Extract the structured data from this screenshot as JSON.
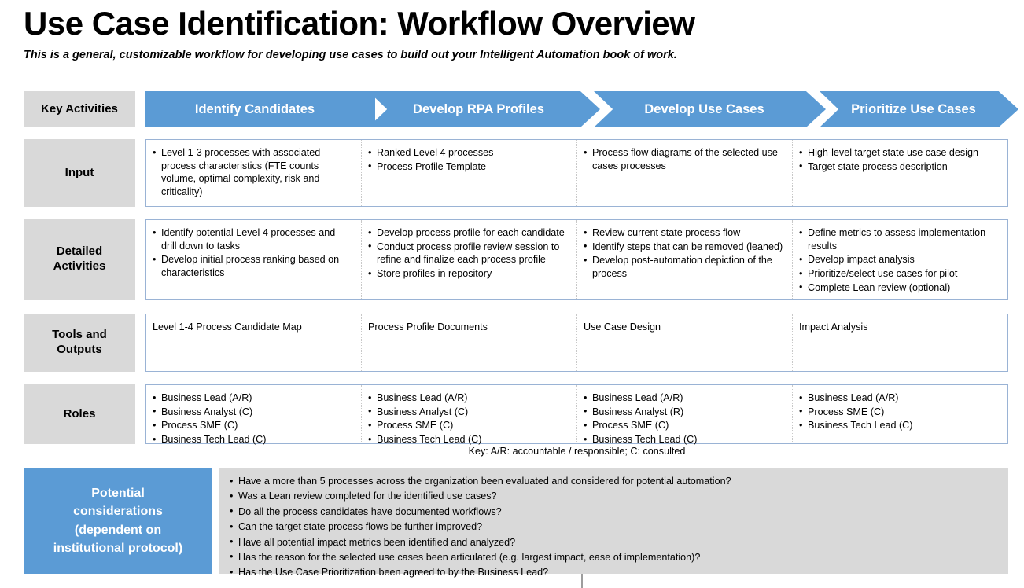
{
  "page": {
    "title": "Use Case Identification: Workflow Overview",
    "subtitle": "This is a general, customizable workflow for developing use cases to build out your Intelligent Automation book of work.",
    "accent_blue": "#5B9BD5",
    "label_gray": "#D9D9D9",
    "border_blue": "#9AB3D5"
  },
  "row_labels": {
    "key_activities": "Key Activities",
    "input": "Input",
    "detailed_activities": "Detailed\nActivities",
    "detailed_activities_line1": "Detailed",
    "detailed_activities_line2": "Activities",
    "tools_and_outputs_line1": "Tools  and",
    "tools_and_outputs_line2": "Outputs",
    "roles": "Roles"
  },
  "phases": [
    {
      "label": "Identify Candidates"
    },
    {
      "label": "Develop RPA Profiles"
    },
    {
      "label": "Develop Use Cases"
    },
    {
      "label": "Prioritize Use Cases"
    }
  ],
  "input_row": {
    "col1": [
      "Level 1-3 processes with associated process characteristics (FTE counts volume, optimal complexity, risk and criticality)"
    ],
    "col2": [
      "Ranked Level 4 processes",
      "Process Profile Template"
    ],
    "col3": [
      "Process flow diagrams of the selected use cases processes"
    ],
    "col4": [
      "High-level target state use case design",
      "Target state process description"
    ]
  },
  "detailed_activities_row": {
    "col1": [
      "Identify potential Level 4 processes and drill down to tasks",
      "Develop initial process  ranking based on characteristics"
    ],
    "col2": [
      "Develop process profile for each candidate",
      "Conduct process profile review session to refine and finalize each process profile",
      "Store profiles in repository"
    ],
    "col3": [
      "Review current state process flow",
      "Identify steps that can be removed (leaned)",
      "Develop post-automation depiction of the process"
    ],
    "col4": [
      "Define metrics to assess implementation results",
      "Develop impact analysis",
      "Prioritize/select use cases for pilot",
      "Complete Lean review (optional)"
    ]
  },
  "tools_outputs_row": {
    "col1": "Level 1-4 Process Candidate Map",
    "col2": "Process Profile Documents",
    "col3": "Use Case Design",
    "col4": "Impact Analysis"
  },
  "roles_row": {
    "col1": [
      "Business Lead (A/R)",
      "Business Analyst (C)",
      "Process SME (C)",
      "Business Tech Lead (C)"
    ],
    "col2": [
      "Business Lead (A/R)",
      "Business Analyst (C)",
      "Process SME (C)",
      "Business Tech Lead (C)"
    ],
    "col3": [
      "Business Lead (A/R)",
      "Business Analyst (R)",
      "Process SME (C)",
      "Business Tech Lead (C)"
    ],
    "col4": [
      "Business Lead (A/R)",
      "Process SME (C)",
      "Business Tech Lead (C)"
    ]
  },
  "key_note": "Key: A/R: accountable / responsible; C: consulted",
  "considerations": {
    "label_line1": "Potential",
    "label_line2": "considerations",
    "label_line3": "(dependent on",
    "label_line4": "institutional protocol)",
    "items": [
      "Have a more than 5 processes across the organization been evaluated and considered for potential automation?",
      "Was a Lean review completed for the identified use cases?",
      "Do all the process candidates have documented workflows?",
      "Can the target state process flows be further improved?",
      "Have all potential impact metrics been identified and analyzed?",
      "Has the reason for the selected use cases been articulated (e.g. largest impact, ease of implementation)?",
      "Has the Use Case Prioritization been agreed to by the Business Lead?"
    ]
  }
}
